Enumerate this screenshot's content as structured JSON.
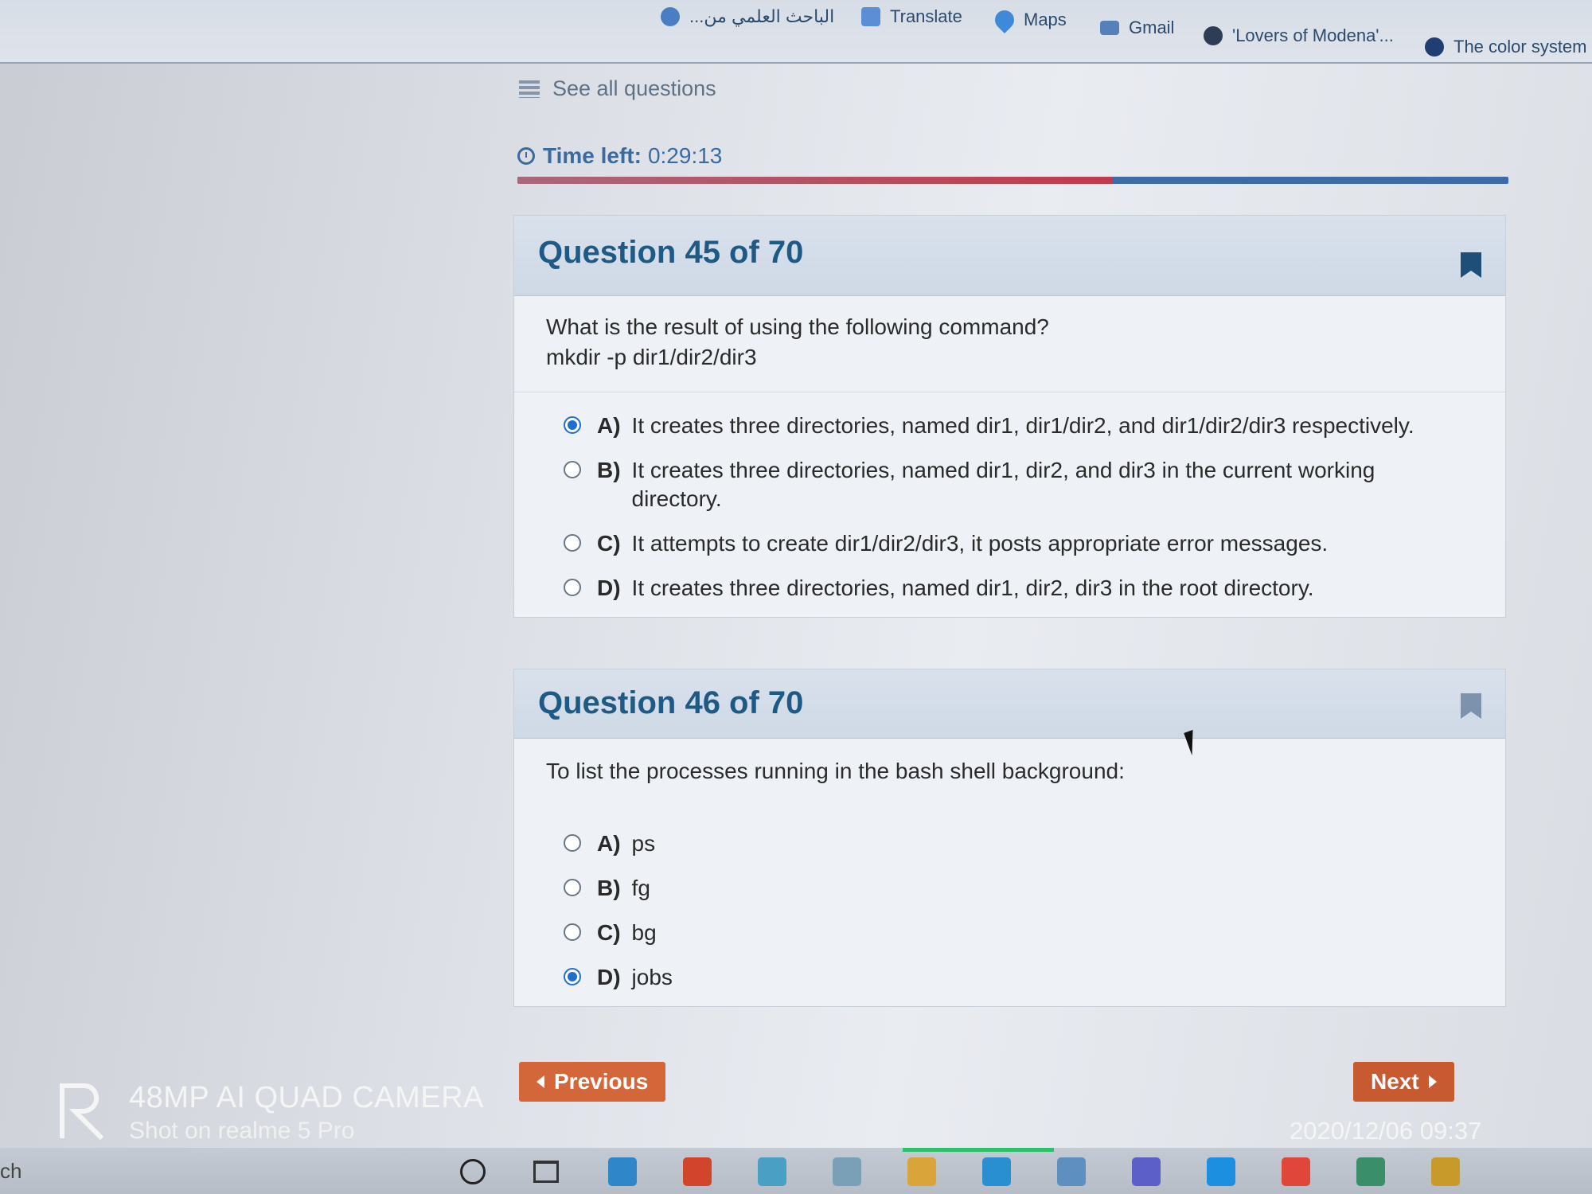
{
  "bookmarks": [
    {
      "label": "...الباحث العلمي من",
      "icon": "scholar-icon",
      "color": "#4a7ec2"
    },
    {
      "label": "Translate",
      "icon": "translate-icon",
      "color": "#5a8fd6"
    },
    {
      "label": "Maps",
      "icon": "maps-pin-icon",
      "color": "#3f8ad8"
    },
    {
      "label": "Gmail",
      "icon": "gmail-icon",
      "color": "#5680b8"
    },
    {
      "label": "'Lovers of Modena'...",
      "icon": "site-icon",
      "color": "#2d3d55"
    },
    {
      "label": "The color system",
      "icon": "vuetify-icon",
      "color": "#1f3f72"
    }
  ],
  "nav": {
    "see_all": "See all questions",
    "time_label": "Time left:",
    "time_value": "0:29:13",
    "progress_fraction": 0.6
  },
  "questions": [
    {
      "title": "Question 45 of 70",
      "prompt_line1": "What is the result of using the following command?",
      "prompt_line2": "mkdir -p dir1/dir2/dir3",
      "options": [
        {
          "letter": "A)",
          "text": "It creates three directories, named dir1, dir1/dir2, and dir1/dir2/dir3 respectively.",
          "selected": true
        },
        {
          "letter": "B)",
          "text": "It creates three directories, named dir1, dir2, and dir3 in the current working directory.",
          "selected": false
        },
        {
          "letter": "C)",
          "text": "It attempts to create dir1/dir2/dir3, it posts appropriate error messages.",
          "selected": false
        },
        {
          "letter": "D)",
          "text": "It creates three directories, named dir1, dir2, dir3 in the root directory.",
          "selected": false
        }
      ]
    },
    {
      "title": "Question 46 of 70",
      "prompt_line1": "To list the processes running in the bash shell background:",
      "options": [
        {
          "letter": "A)",
          "text": "ps",
          "selected": false
        },
        {
          "letter": "B)",
          "text": "fg",
          "selected": false
        },
        {
          "letter": "C)",
          "text": "bg",
          "selected": false
        },
        {
          "letter": "D)",
          "text": "jobs",
          "selected": true
        }
      ]
    }
  ],
  "buttons": {
    "previous": "Previous",
    "next": "Next"
  },
  "watermark": {
    "line1": "48MP AI QUAD CAMERA",
    "line2": "Shot on realme 5 Pro",
    "date": "2020/12/06 09:37"
  },
  "taskbar": {
    "search_text": "ch",
    "apps": [
      {
        "icon": "store-icon",
        "color": "#2f86c9"
      },
      {
        "icon": "office-icon",
        "color": "#d2452c"
      },
      {
        "icon": "photos-icon",
        "color": "#4aa0c4"
      },
      {
        "icon": "paint-icon",
        "color": "#7aa0b8"
      },
      {
        "icon": "file-explorer-icon",
        "color": "#d9a53a"
      },
      {
        "icon": "maps-app-icon",
        "color": "#2a8fd0"
      },
      {
        "icon": "notes-icon",
        "color": "#5d8fc0"
      },
      {
        "icon": "teams-icon",
        "color": "#5b5fc7"
      },
      {
        "icon": "chat-icon",
        "color": "#1d8fe0"
      },
      {
        "icon": "chrome-icon",
        "color": "#e0463a"
      },
      {
        "icon": "visio-icon",
        "color": "#3a8f6a"
      },
      {
        "icon": "python-icon",
        "color": "#c79a2a"
      }
    ]
  }
}
